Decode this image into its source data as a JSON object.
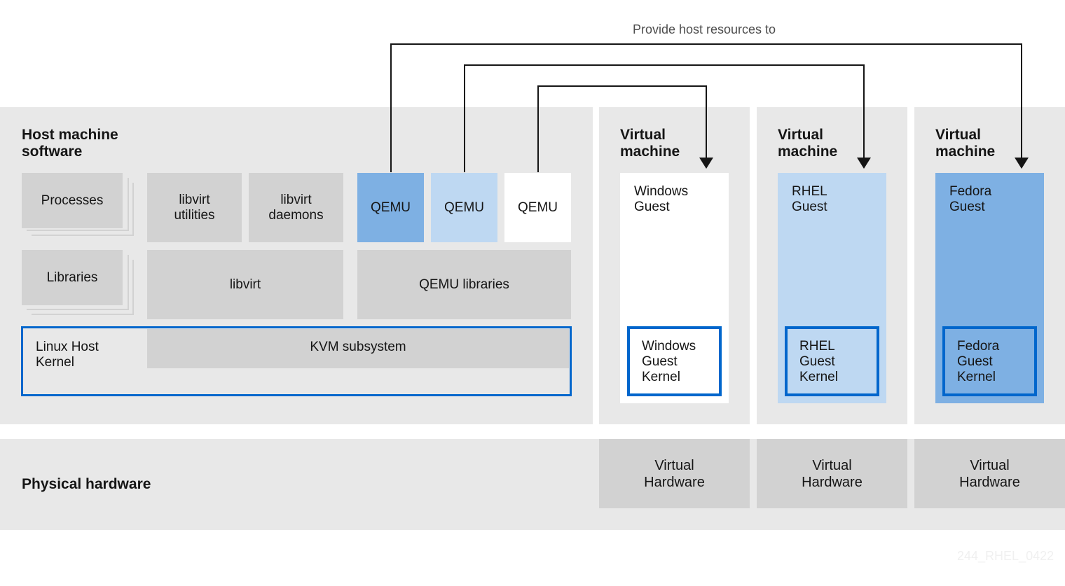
{
  "caption": "Provide host resources to",
  "host": {
    "title": "Host machine\nsoftware",
    "processes": "Processes",
    "libraries": "Libraries",
    "libvirt_utilities": "libvirt\nutilities",
    "libvirt_daemons": "libvirt\ndaemons",
    "libvirt": "libvirt",
    "qemu": [
      "QEMU",
      "QEMU",
      "QEMU"
    ],
    "qemu_libraries": "QEMU libraries",
    "kernel_label": "Linux Host\nKernel",
    "kvm": "KVM subsystem"
  },
  "vms": [
    {
      "title": "Virtual\nmachine",
      "guest": "Windows\nGuest",
      "kernel": "Windows\nGuest\nKernel",
      "hardware": "Virtual\nHardware"
    },
    {
      "title": "Virtual\nmachine",
      "guest": "RHEL\nGuest",
      "kernel": "RHEL\nGuest\nKernel",
      "hardware": "Virtual\nHardware"
    },
    {
      "title": "Virtual\nmachine",
      "guest": "Fedora\nGuest",
      "kernel": "Fedora\nGuest\nKernel",
      "hardware": "Virtual\nHardware"
    }
  ],
  "physical": "Physical hardware",
  "watermark": "244_RHEL_0422",
  "colors": {
    "panel": "#e8e8e8",
    "box": "#d2d2d2",
    "blue_dark": "#7eb0e3",
    "blue_light": "#bed8f2",
    "white": "#ffffff",
    "kernel_border": "#0066cc"
  }
}
